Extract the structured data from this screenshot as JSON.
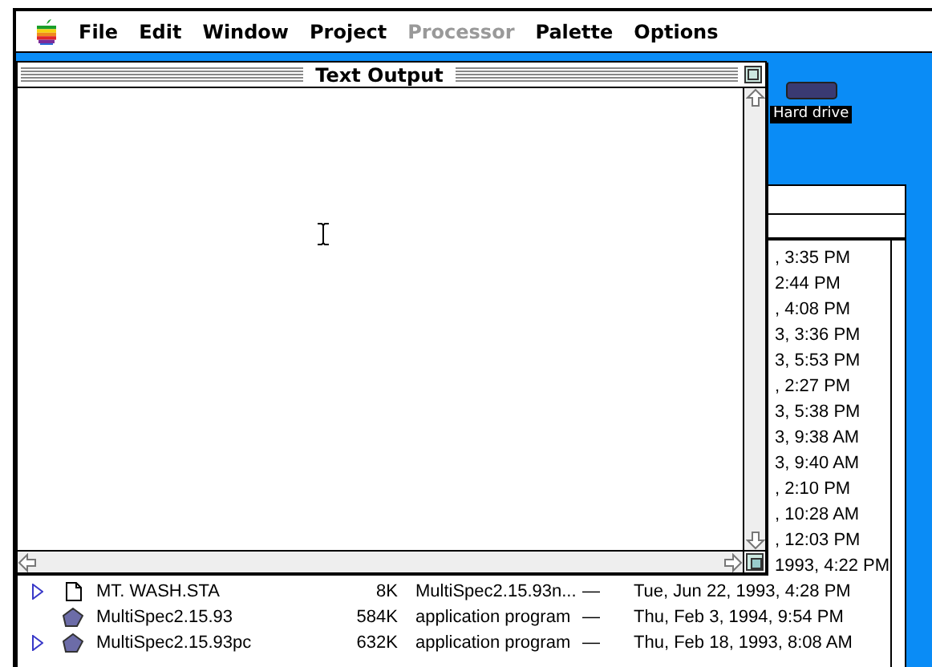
{
  "menu_bar": {
    "items": [
      {
        "label": "File",
        "disabled": false
      },
      {
        "label": "Edit",
        "disabled": false
      },
      {
        "label": "Window",
        "disabled": false
      },
      {
        "label": "Project",
        "disabled": false
      },
      {
        "label": "Processor",
        "disabled": true
      },
      {
        "label": "Palette",
        "disabled": false
      },
      {
        "label": "Options",
        "disabled": false
      }
    ]
  },
  "desktop": {
    "icons": [
      {
        "label": "Hard drive"
      }
    ]
  },
  "text_output_window": {
    "title": "Text Output"
  },
  "finder_window": {
    "rows": [
      {
        "kind": "partial",
        "date": ", 3:35 PM"
      },
      {
        "kind": "partial",
        "date": "2:44 PM"
      },
      {
        "kind": "partial",
        "date": ", 4:08 PM"
      },
      {
        "kind": "partial",
        "date": "3, 3:36 PM"
      },
      {
        "kind": "partial",
        "date": "3, 5:53 PM"
      },
      {
        "kind": "partial",
        "date": ", 2:27 PM"
      },
      {
        "kind": "partial",
        "date": "3, 5:38 PM"
      },
      {
        "kind": "partial",
        "date": "3, 9:38 AM"
      },
      {
        "kind": "partial",
        "date": "3, 9:40 AM"
      },
      {
        "kind": "partial",
        "date": ", 2:10 PM"
      },
      {
        "kind": "partial",
        "date": ", 10:28 AM"
      },
      {
        "kind": "partial",
        "date": ", 12:03 PM"
      },
      {
        "kind": "partial",
        "date": "1993, 4:22 PM"
      },
      {
        "kind": "document",
        "expandable": true,
        "name": "MT. WASH.STA",
        "size": "8K",
        "type": "MultiSpec2.15.93n...",
        "label": "—",
        "date": "Tue, Jun 22, 1993, 4:28 PM"
      },
      {
        "kind": "application",
        "expandable": false,
        "name": "MultiSpec2.15.93",
        "size": "584K",
        "type": "application program",
        "label": "—",
        "date": "Thu, Feb 3, 1994, 9:54 PM"
      },
      {
        "kind": "application",
        "expandable": true,
        "name": "MultiSpec2.15.93pc",
        "size": "632K",
        "type": "application program",
        "label": "—",
        "date": "Thu, Feb 18, 1993, 8:08 AM"
      }
    ]
  }
}
